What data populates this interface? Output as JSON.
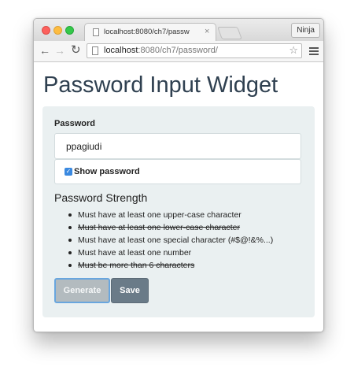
{
  "browser": {
    "tab_title": "localhost:8080/ch7/passw",
    "tab_close_glyph": "×",
    "profile_button": "Ninja",
    "url_host": "localhost",
    "url_path": ":8080/ch7/password/",
    "icons": {
      "back": "back-arrow-icon",
      "forward": "forward-arrow-icon",
      "reload": "reload-icon",
      "bookmark": "star-icon",
      "menu": "hamburger-menu-icon",
      "page": "page-icon"
    }
  },
  "page": {
    "title": "Password Input Widget",
    "password_label": "Password",
    "password_value": "ppagiudi",
    "show_password": {
      "label": "Show password",
      "checked": true
    },
    "strength_heading": "Password Strength",
    "rules": [
      {
        "text": "Must have at least one upper-case character",
        "satisfied": false
      },
      {
        "text": "Must have at least one lower-case character",
        "satisfied": true
      },
      {
        "text": "Must have at least one special character (#$@!&%...)",
        "satisfied": false
      },
      {
        "text": "Must have at least one number",
        "satisfied": false
      },
      {
        "text": "Must be more than 6 characters",
        "satisfied": true
      }
    ],
    "buttons": {
      "generate": "Generate",
      "save": "Save"
    }
  },
  "colors": {
    "title": "#2f4050",
    "panel_bg": "#eaf0f1",
    "checkbox": "#3a89e0",
    "save_button": "#6a7b88",
    "generate_button": "#b3bbbf",
    "focus_ring": "#69a6de"
  }
}
